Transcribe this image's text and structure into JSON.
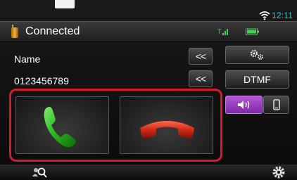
{
  "status": {
    "time": "12:11"
  },
  "title_bar": {
    "title": "Connected"
  },
  "contact": {
    "name": "Name",
    "number": "0123456789"
  },
  "buttons": {
    "chevron_label": "<<",
    "dtmf_label": "DTMF"
  },
  "icons": {
    "wifi": "wifi-icon",
    "phone": "phone-icon",
    "signal": "signal-icon",
    "battery": "battery-icon",
    "settings": "settings-icon",
    "speaker": "speaker-icon",
    "handset": "handset-icon",
    "answer": "answer-call-icon",
    "hangup": "end-call-icon",
    "search": "search-icon",
    "gear": "gear-icon"
  },
  "colors": {
    "clock": "#2ec4d4",
    "highlight_frame": "#d01f2b",
    "answer_green": "#29b51e",
    "hangup_red": "#d22b18",
    "speaker_active": "#9a3fc4"
  }
}
